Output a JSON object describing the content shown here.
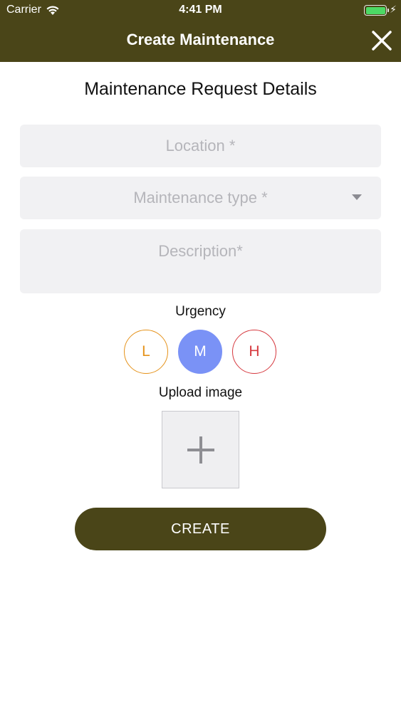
{
  "status_bar": {
    "carrier": "Carrier",
    "time": "4:41 PM",
    "battery_color": "#4cd964"
  },
  "nav": {
    "title": "Create Maintenance",
    "close_icon": "close-icon",
    "background_color": "#4a4518"
  },
  "form": {
    "section_title": "Maintenance Request Details",
    "location_placeholder": "Location *",
    "maintenance_type_placeholder": "Maintenance type *",
    "description_placeholder": "Description*",
    "urgency_label": "Urgency",
    "urgency_options": [
      {
        "label": "L",
        "color": "#e5921a",
        "selected": false
      },
      {
        "label": "M",
        "color": "#7a92f6",
        "selected": true
      },
      {
        "label": "H",
        "color": "#d6393f",
        "selected": false
      }
    ],
    "upload_label": "Upload image",
    "upload_icon": "plus-icon",
    "create_label": "CREATE"
  }
}
